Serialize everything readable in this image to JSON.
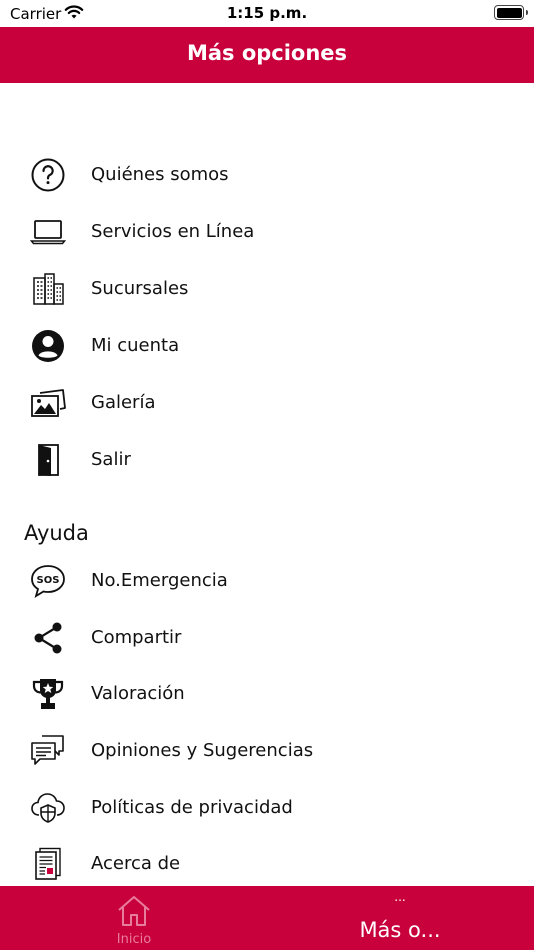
{
  "status_bar": {
    "carrier": "Carrier",
    "time": "1:15 p.m."
  },
  "nav": {
    "title": "Más opciones"
  },
  "menu": {
    "items": [
      {
        "label": "Quiénes somos",
        "icon": "question-circle-icon"
      },
      {
        "label": "Servicios en Línea",
        "icon": "laptop-icon"
      },
      {
        "label": "Sucursales",
        "icon": "buildings-icon"
      },
      {
        "label": "Mi cuenta",
        "icon": "account-circle-icon"
      },
      {
        "label": "Galería",
        "icon": "gallery-icon"
      },
      {
        "label": "Salir",
        "icon": "door-exit-icon"
      }
    ]
  },
  "help": {
    "header": "Ayuda",
    "items": [
      {
        "label": "No.Emergencia",
        "icon": "sos-icon",
        "icon_text": "SOS"
      },
      {
        "label": "Compartir",
        "icon": "share-icon"
      },
      {
        "label": "Valoración",
        "icon": "trophy-icon"
      },
      {
        "label": "Opiniones y Sugerencias",
        "icon": "chat-bubbles-icon"
      },
      {
        "label": "Políticas de privacidad",
        "icon": "cloud-shield-icon"
      },
      {
        "label": "Acerca de",
        "icon": "document-icon"
      }
    ]
  },
  "tab_bar": {
    "tabs": [
      {
        "label": "Inicio",
        "icon": "home-icon",
        "active": false
      },
      {
        "label": "Más o...",
        "dots": "...",
        "active": true
      }
    ]
  },
  "colors": {
    "brand": "#c8003c",
    "inactive_tab": "#e87c9c"
  }
}
